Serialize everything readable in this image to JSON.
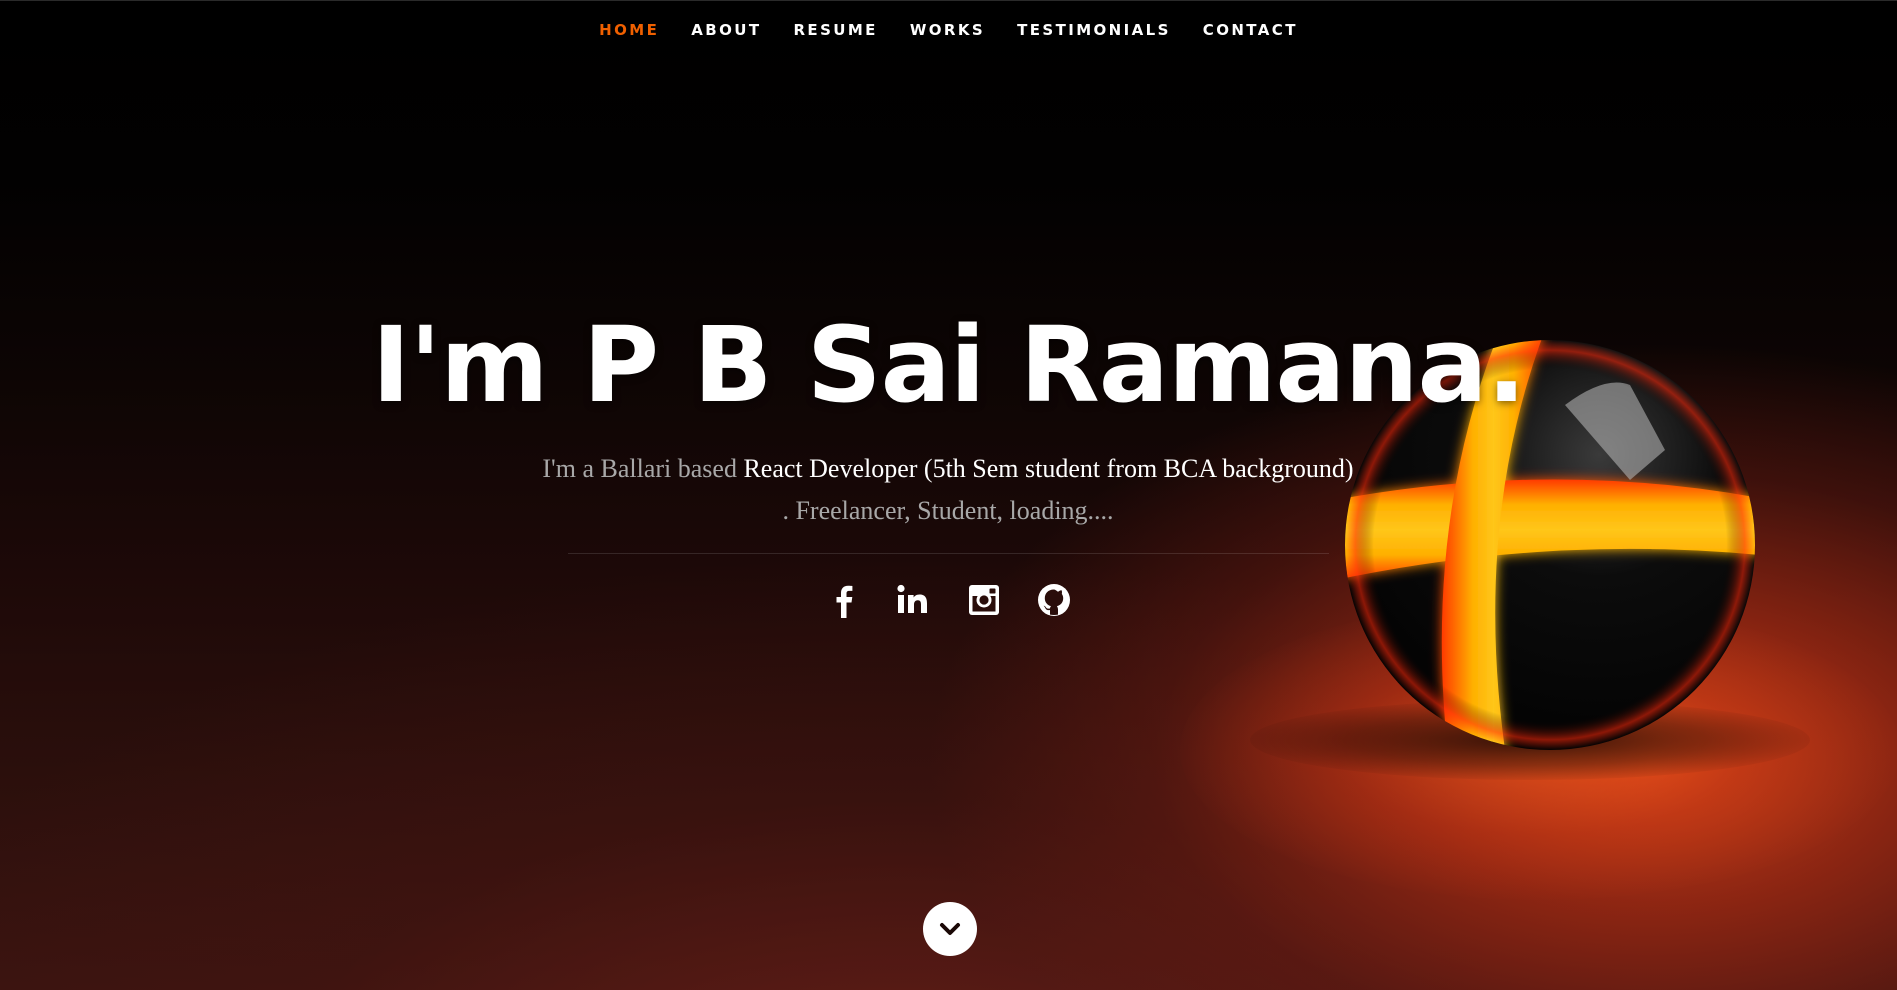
{
  "nav": {
    "items": [
      {
        "label": "HOME",
        "active": true
      },
      {
        "label": "ABOUT",
        "active": false
      },
      {
        "label": "RESUME",
        "active": false
      },
      {
        "label": "WORKS",
        "active": false
      },
      {
        "label": "TESTIMONIALS",
        "active": false
      },
      {
        "label": "CONTACT",
        "active": false
      }
    ],
    "active_color": "#f06000"
  },
  "hero": {
    "title": "I'm P B Sai Ramana.",
    "subtitle_prefix": "I'm a Ballari based ",
    "subtitle_highlight": "React Developer (5th Sem student from BCA background)",
    "subtitle_suffix": ". Freelancer, Student, loading...."
  },
  "socials": [
    {
      "icon": "facebook-icon"
    },
    {
      "icon": "linkedin-icon"
    },
    {
      "icon": "instagram-icon"
    },
    {
      "icon": "github-icon"
    }
  ],
  "scroll_down": {
    "icon": "chevron-down-icon"
  },
  "colors": {
    "accent": "#f06000",
    "text": "#ffffff",
    "muted": "#a8a8a8",
    "orb_glow": "#ffb000"
  }
}
